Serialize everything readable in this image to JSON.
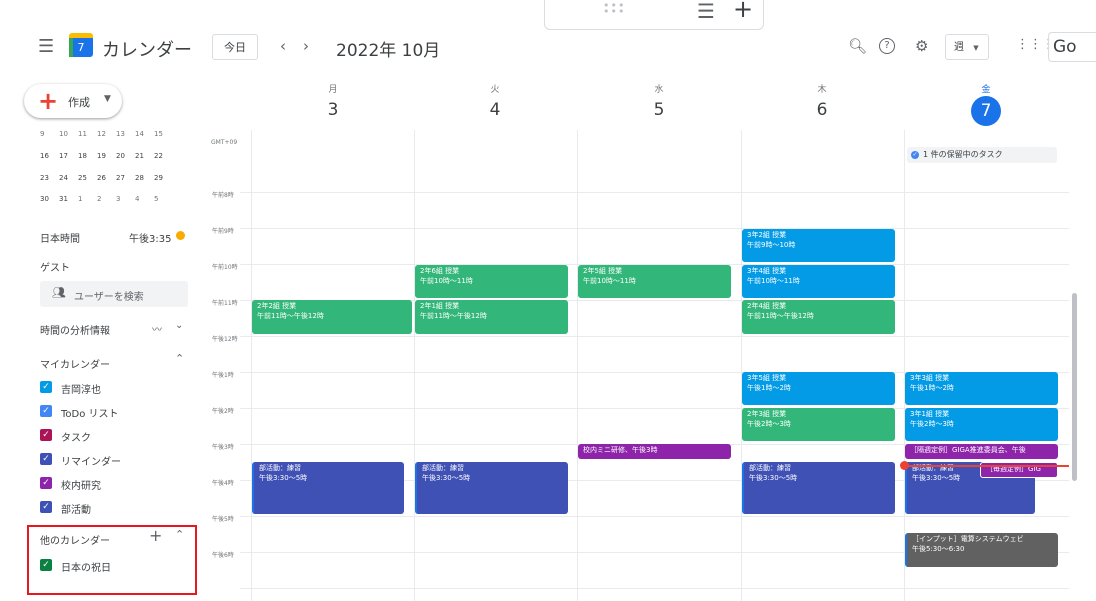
{
  "header": {
    "app_title": "カレンダー",
    "logo_day": "7",
    "today_label": "今日",
    "date_title": "2022年 10月",
    "view_label": "週",
    "account_text": "Go"
  },
  "create": {
    "label": "作成"
  },
  "days": [
    {
      "dow": "月",
      "num": "3"
    },
    {
      "dow": "火",
      "num": "4"
    },
    {
      "dow": "水",
      "num": "5"
    },
    {
      "dow": "木",
      "num": "6"
    },
    {
      "dow": "金",
      "num": "7"
    }
  ],
  "mini_calendar": {
    "rows": [
      [
        "9",
        "10",
        "11",
        "12",
        "13",
        "14",
        "15"
      ],
      [
        "16",
        "17",
        "18",
        "19",
        "20",
        "21",
        "22"
      ],
      [
        "23",
        "24",
        "25",
        "26",
        "27",
        "28",
        "29"
      ],
      [
        "30",
        "31",
        "1",
        "2",
        "3",
        "4",
        "5"
      ]
    ]
  },
  "sidebar": {
    "timezone_label": "日本時間",
    "timezone_time": "午後3:35",
    "guests_label": "ゲスト",
    "search_users_placeholder": "ユーザーを検索",
    "time_insights_label": "時間の分析情報",
    "my_calendars_label": "マイカレンダー",
    "my_calendars": [
      {
        "name": "吉岡淳也",
        "color": "#039be5"
      },
      {
        "name": "ToDo リスト",
        "color": "#4285f4"
      },
      {
        "name": "タスク",
        "color": "#ad1457"
      },
      {
        "name": "リマインダー",
        "color": "#3f51b5"
      },
      {
        "name": "校内研究",
        "color": "#8e24aa"
      },
      {
        "name": "部活動",
        "color": "#3f51b5"
      }
    ],
    "other_calendars_label": "他のカレンダー",
    "other_calendars": [
      {
        "name": "日本の祝日",
        "color": "#0b8043"
      }
    ]
  },
  "grid": {
    "gmt_label": "GMT+09",
    "time_labels": [
      "午前8時",
      "午前9時",
      "午前10時",
      "午前11時",
      "午後12時",
      "午後1時",
      "午後2時",
      "午後3時",
      "午後4時",
      "午後5時",
      "午後6時"
    ]
  },
  "task_chip": "1 件の保留中のタスク",
  "events": [
    {
      "id": "e1",
      "title": "2年2組 授業",
      "time": "午前11時～午後12時",
      "color": "green"
    },
    {
      "id": "e2",
      "title": "部活動：練習",
      "time": "午後3:30～5時",
      "color": "indigo"
    },
    {
      "id": "e3",
      "title": "2年6組 授業",
      "time": "午前10時～11時",
      "color": "green"
    },
    {
      "id": "e4",
      "title": "2年1組 授業",
      "time": "午前11時～午後12時",
      "color": "green"
    },
    {
      "id": "e5",
      "title": "部活動：練習",
      "time": "午後3:30～5時",
      "color": "indigo"
    },
    {
      "id": "e6",
      "title": "2年5組 授業",
      "time": "午前10時～11時",
      "color": "green"
    },
    {
      "id": "e7",
      "title": "校内ミニ研修、午後3時",
      "time": "",
      "color": "purple"
    },
    {
      "id": "e8",
      "title": "3年2組 授業",
      "time": "午前9時～10時",
      "color": "blue"
    },
    {
      "id": "e9",
      "title": "3年4組 授業",
      "time": "午前10時～11時",
      "color": "blue"
    },
    {
      "id": "e10",
      "title": "2年4組 授業",
      "time": "午前11時～午後12時",
      "color": "green"
    },
    {
      "id": "e11",
      "title": "3年5組 授業",
      "time": "午後1時～2時",
      "color": "blue"
    },
    {
      "id": "e12",
      "title": "2年3組 授業",
      "time": "午後2時～3時",
      "color": "green"
    },
    {
      "id": "e13",
      "title": "部活動：練習",
      "time": "午後3:30～5時",
      "color": "indigo"
    },
    {
      "id": "e14",
      "title": "3年3組 授業",
      "time": "午後1時～2時",
      "color": "blue"
    },
    {
      "id": "e15",
      "title": "3年1組 授業",
      "time": "午後2時～3時",
      "color": "blue"
    },
    {
      "id": "e16",
      "title": "［隔週定例］GIGA推進委員会、午後",
      "time": "",
      "color": "purple"
    },
    {
      "id": "e17",
      "title": "部活動：練習",
      "time": "午後3:30～5時",
      "color": "indigo"
    },
    {
      "id": "e18",
      "title": "［毎週定例］GIG",
      "time": "",
      "color": "purple"
    },
    {
      "id": "e19",
      "title": "［インプット］電算システムウェビ",
      "time": "午後5:30～6:30",
      "color": "gray"
    }
  ]
}
